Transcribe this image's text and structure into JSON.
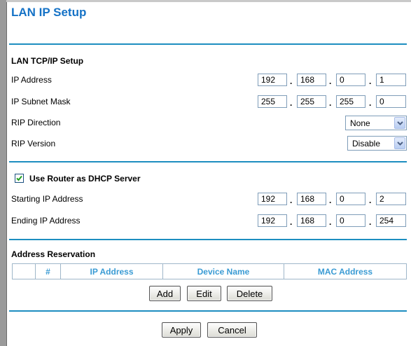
{
  "page": {
    "title": "LAN IP Setup"
  },
  "lan_tcpip": {
    "heading": "LAN TCP/IP Setup",
    "ip_address": {
      "label": "IP Address",
      "octets": [
        "192",
        "168",
        "0",
        "1"
      ]
    },
    "subnet_mask": {
      "label": "IP Subnet Mask",
      "octets": [
        "255",
        "255",
        "255",
        "0"
      ]
    },
    "rip_direction": {
      "label": "RIP Direction",
      "selected": "None"
    },
    "rip_version": {
      "label": "RIP Version",
      "selected": "Disable"
    }
  },
  "dhcp": {
    "checkbox_label": "Use Router as DHCP Server",
    "checked": true,
    "start_ip": {
      "label": "Starting IP Address",
      "octets": [
        "192",
        "168",
        "0",
        "2"
      ]
    },
    "end_ip": {
      "label": "Ending IP Address",
      "octets": [
        "192",
        "168",
        "0",
        "254"
      ]
    }
  },
  "reservation": {
    "heading": "Address Reservation",
    "columns": [
      "",
      "#",
      "IP Address",
      "Device Name",
      "MAC Address"
    ],
    "buttons": {
      "add": "Add",
      "edit": "Edit",
      "delete": "Delete"
    }
  },
  "footer": {
    "apply": "Apply",
    "cancel": "Cancel"
  },
  "colors": {
    "title": "#1572c6",
    "rule": "#1d8ec0",
    "column_header": "#3a9bd4"
  },
  "icons": {
    "dropdown": "chevron-down-icon",
    "check": "checkmark-icon"
  }
}
